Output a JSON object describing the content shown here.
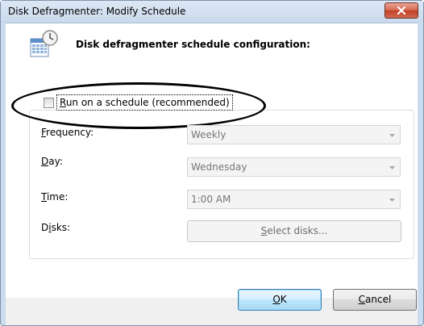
{
  "window": {
    "title": "Disk Defragmenter: Modify Schedule",
    "close_glyph": "✕"
  },
  "header": {
    "text": "Disk defragmenter schedule configuration:",
    "icon": "calendar-clock-icon"
  },
  "schedule": {
    "run_label_first": "R",
    "run_label_rest": "un on a schedule (recommended)",
    "checked": false
  },
  "fields": {
    "frequency": {
      "label_first": "F",
      "label_rest": "requency:",
      "value": "Weekly"
    },
    "day": {
      "label_first": "D",
      "label_rest": "ay:",
      "value": "Wednesday"
    },
    "time": {
      "label_first": "T",
      "label_rest": "ime:",
      "value": "1:00 AM"
    },
    "disks": {
      "label_pre": "D",
      "label_accel": "i",
      "label_post": "sks:",
      "button_first": "S",
      "button_rest": "elect disks..."
    }
  },
  "buttons": {
    "ok_first": "O",
    "ok_rest": "K",
    "cancel_first": "C",
    "cancel_rest": "ancel"
  },
  "colors": {
    "frame": "#ccdcef",
    "close_button": "#c13f25",
    "ok_border": "#3c7fb1",
    "disabled_text": "#777777"
  }
}
